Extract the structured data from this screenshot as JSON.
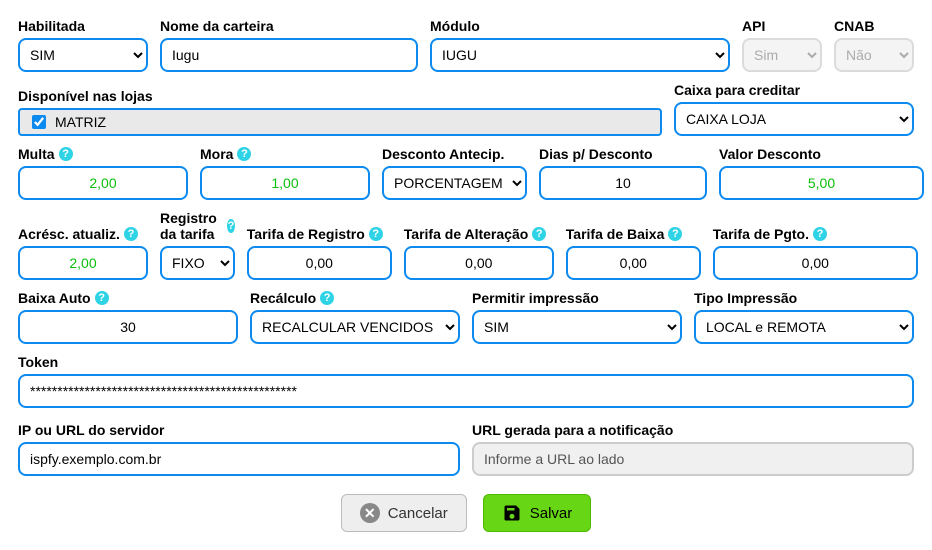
{
  "row1": {
    "habilitada": {
      "label": "Habilitada",
      "value": "SIM"
    },
    "nome_carteira": {
      "label": "Nome da carteira",
      "value": "Iugu"
    },
    "modulo": {
      "label": "Módulo",
      "value": "IUGU"
    },
    "api": {
      "label": "API",
      "value": "Sim"
    },
    "cnab": {
      "label": "CNAB",
      "value": "Não"
    }
  },
  "row2": {
    "disponivel_lojas": {
      "label": "Disponível nas lojas",
      "checkbox_label": "MATRIZ",
      "checked": true
    },
    "caixa_creditar": {
      "label": "Caixa para creditar",
      "value": "CAIXA LOJA"
    }
  },
  "row3": {
    "multa": {
      "label": "Multa",
      "value": "2,00"
    },
    "mora": {
      "label": "Mora",
      "value": "1,00"
    },
    "desconto_antecip": {
      "label": "Desconto Antecip.",
      "value": "PORCENTAGEM"
    },
    "dias_desconto": {
      "label": "Dias p/ Desconto",
      "value": "10"
    },
    "valor_desconto": {
      "label": "Valor Desconto",
      "value": "5,00"
    }
  },
  "row4": {
    "acresc_atualiz": {
      "label": "Acrésc. atualiz.",
      "value": "2,00"
    },
    "registro_tarifa": {
      "label": "Registro da tarifa",
      "value": "FIXO"
    },
    "tarifa_registro": {
      "label": "Tarifa de Registro",
      "value": "0,00"
    },
    "tarifa_alteracao": {
      "label": "Tarifa de Alteração",
      "value": "0,00"
    },
    "tarifa_baixa": {
      "label": "Tarifa de Baixa",
      "value": "0,00"
    },
    "tarifa_pgto": {
      "label": "Tarifa de Pgto.",
      "value": "0,00"
    }
  },
  "row5": {
    "baixa_auto": {
      "label": "Baixa Auto",
      "value": "30"
    },
    "recalculo": {
      "label": "Recálculo",
      "value": "RECALCULAR VENCIDOS"
    },
    "permitir_impressao": {
      "label": "Permitir impressão",
      "value": "SIM"
    },
    "tipo_impressao": {
      "label": "Tipo Impressão",
      "value": "LOCAL e REMOTA"
    }
  },
  "row6": {
    "token": {
      "label": "Token",
      "value": "*************************************************"
    }
  },
  "row7": {
    "ip_url": {
      "label": "IP ou URL do servidor",
      "value": "ispfy.exemplo.com.br"
    },
    "url_notificacao": {
      "label": "URL gerada para a notificação",
      "value": "Informe a URL ao lado"
    }
  },
  "buttons": {
    "cancel": "Cancelar",
    "save": "Salvar"
  }
}
